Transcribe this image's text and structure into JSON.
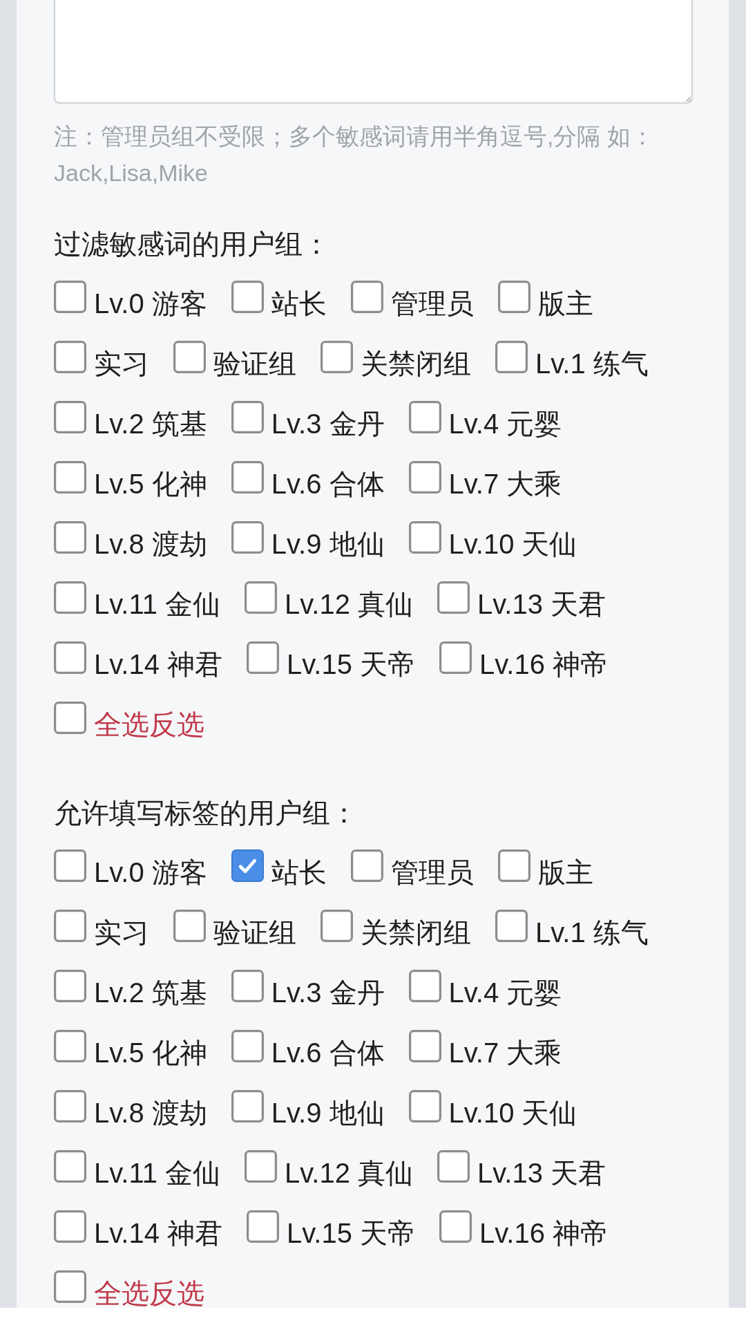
{
  "note": "注：管理员组不受限；多个敏感词请用半角逗号,分隔 如：Jack,Lisa,Mike",
  "groups": [
    {
      "title": "过滤敏感词的用户组：",
      "options": [
        {
          "label": "Lv.0 游客",
          "checked": false,
          "kind": "group"
        },
        {
          "label": "站长",
          "checked": false,
          "kind": "group"
        },
        {
          "label": "管理员",
          "checked": false,
          "kind": "group"
        },
        {
          "label": "版主",
          "checked": false,
          "kind": "group"
        },
        {
          "label": "实习",
          "checked": false,
          "kind": "group"
        },
        {
          "label": "验证组",
          "checked": false,
          "kind": "group"
        },
        {
          "label": "关禁闭组",
          "checked": false,
          "kind": "group"
        },
        {
          "label": "Lv.1 练气",
          "checked": false,
          "kind": "group"
        },
        {
          "label": "Lv.2 筑基",
          "checked": false,
          "kind": "group"
        },
        {
          "label": "Lv.3 金丹",
          "checked": false,
          "kind": "group"
        },
        {
          "label": "Lv.4 元婴",
          "checked": false,
          "kind": "group"
        },
        {
          "label": "Lv.5 化神",
          "checked": false,
          "kind": "group"
        },
        {
          "label": "Lv.6 合体",
          "checked": false,
          "kind": "group"
        },
        {
          "label": "Lv.7 大乘",
          "checked": false,
          "kind": "group"
        },
        {
          "label": "Lv.8 渡劫",
          "checked": false,
          "kind": "group"
        },
        {
          "label": "Lv.9 地仙",
          "checked": false,
          "kind": "group"
        },
        {
          "label": "Lv.10 天仙",
          "checked": false,
          "kind": "group"
        },
        {
          "label": "Lv.11 金仙",
          "checked": false,
          "kind": "group"
        },
        {
          "label": "Lv.12 真仙",
          "checked": false,
          "kind": "group"
        },
        {
          "label": "Lv.13 天君",
          "checked": false,
          "kind": "group"
        },
        {
          "label": "Lv.14 神君",
          "checked": false,
          "kind": "group"
        },
        {
          "label": "Lv.15 天帝",
          "checked": false,
          "kind": "group"
        },
        {
          "label": "Lv.16 神帝",
          "checked": false,
          "kind": "group"
        },
        {
          "label": "全选反选",
          "checked": false,
          "kind": "select_all"
        }
      ]
    },
    {
      "title": "允许填写标签的用户组：",
      "options": [
        {
          "label": "Lv.0 游客",
          "checked": false,
          "kind": "group"
        },
        {
          "label": "站长",
          "checked": true,
          "kind": "group"
        },
        {
          "label": "管理员",
          "checked": false,
          "kind": "group"
        },
        {
          "label": "版主",
          "checked": false,
          "kind": "group"
        },
        {
          "label": "实习",
          "checked": false,
          "kind": "group"
        },
        {
          "label": "验证组",
          "checked": false,
          "kind": "group"
        },
        {
          "label": "关禁闭组",
          "checked": false,
          "kind": "group"
        },
        {
          "label": "Lv.1 练气",
          "checked": false,
          "kind": "group"
        },
        {
          "label": "Lv.2 筑基",
          "checked": false,
          "kind": "group"
        },
        {
          "label": "Lv.3 金丹",
          "checked": false,
          "kind": "group"
        },
        {
          "label": "Lv.4 元婴",
          "checked": false,
          "kind": "group"
        },
        {
          "label": "Lv.5 化神",
          "checked": false,
          "kind": "group"
        },
        {
          "label": "Lv.6 合体",
          "checked": false,
          "kind": "group"
        },
        {
          "label": "Lv.7 大乘",
          "checked": false,
          "kind": "group"
        },
        {
          "label": "Lv.8 渡劫",
          "checked": false,
          "kind": "group"
        },
        {
          "label": "Lv.9 地仙",
          "checked": false,
          "kind": "group"
        },
        {
          "label": "Lv.10 天仙",
          "checked": false,
          "kind": "group"
        },
        {
          "label": "Lv.11 金仙",
          "checked": false,
          "kind": "group"
        },
        {
          "label": "Lv.12 真仙",
          "checked": false,
          "kind": "group"
        },
        {
          "label": "Lv.13 天君",
          "checked": false,
          "kind": "group"
        },
        {
          "label": "Lv.14 神君",
          "checked": false,
          "kind": "group"
        },
        {
          "label": "Lv.15 天帝",
          "checked": false,
          "kind": "group"
        },
        {
          "label": "Lv.16 神帝",
          "checked": false,
          "kind": "group"
        },
        {
          "label": "全选反选",
          "checked": false,
          "kind": "select_all"
        }
      ]
    }
  ]
}
